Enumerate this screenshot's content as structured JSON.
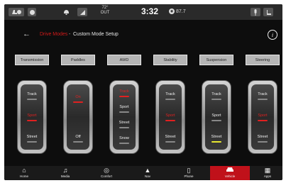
{
  "status": {
    "temp": "72°",
    "temp_label": "OUT",
    "time": "3:32",
    "radio": "87.7"
  },
  "header": {
    "back": "←",
    "crumb_parent": "Drive Modes",
    "separator": "-",
    "title": "Custom Mode Setup",
    "info": "i"
  },
  "categories": [
    "Transmission",
    "Paddles",
    "AWD",
    "Stability",
    "Suspension",
    "Steering"
  ],
  "sliders": [
    {
      "options": [
        "Track",
        "Sport",
        "Street"
      ],
      "active": "Sport"
    },
    {
      "options": [
        "On",
        "Off"
      ],
      "active": "On"
    },
    {
      "options": [
        "Track",
        "Sport",
        "Street",
        "Snow"
      ],
      "active": "Track"
    },
    {
      "options": [
        "Track",
        "Sport",
        "Street"
      ],
      "active": "Sport"
    },
    {
      "options": [
        "Track",
        "Sport",
        "Street"
      ],
      "active": "Street"
    },
    {
      "options": [
        "Track",
        "Sport",
        "Street"
      ],
      "active": "Sport"
    }
  ],
  "nav": {
    "home": "Home",
    "media": "Media",
    "comfort": "Comfort",
    "nav": "Nav",
    "phone": "Phone",
    "vehicle": "Vehicle",
    "apps": "Apps"
  },
  "colors": {
    "accent": "#c0111a",
    "active_text": "#e02020",
    "suspension_active": "#e8e830"
  }
}
